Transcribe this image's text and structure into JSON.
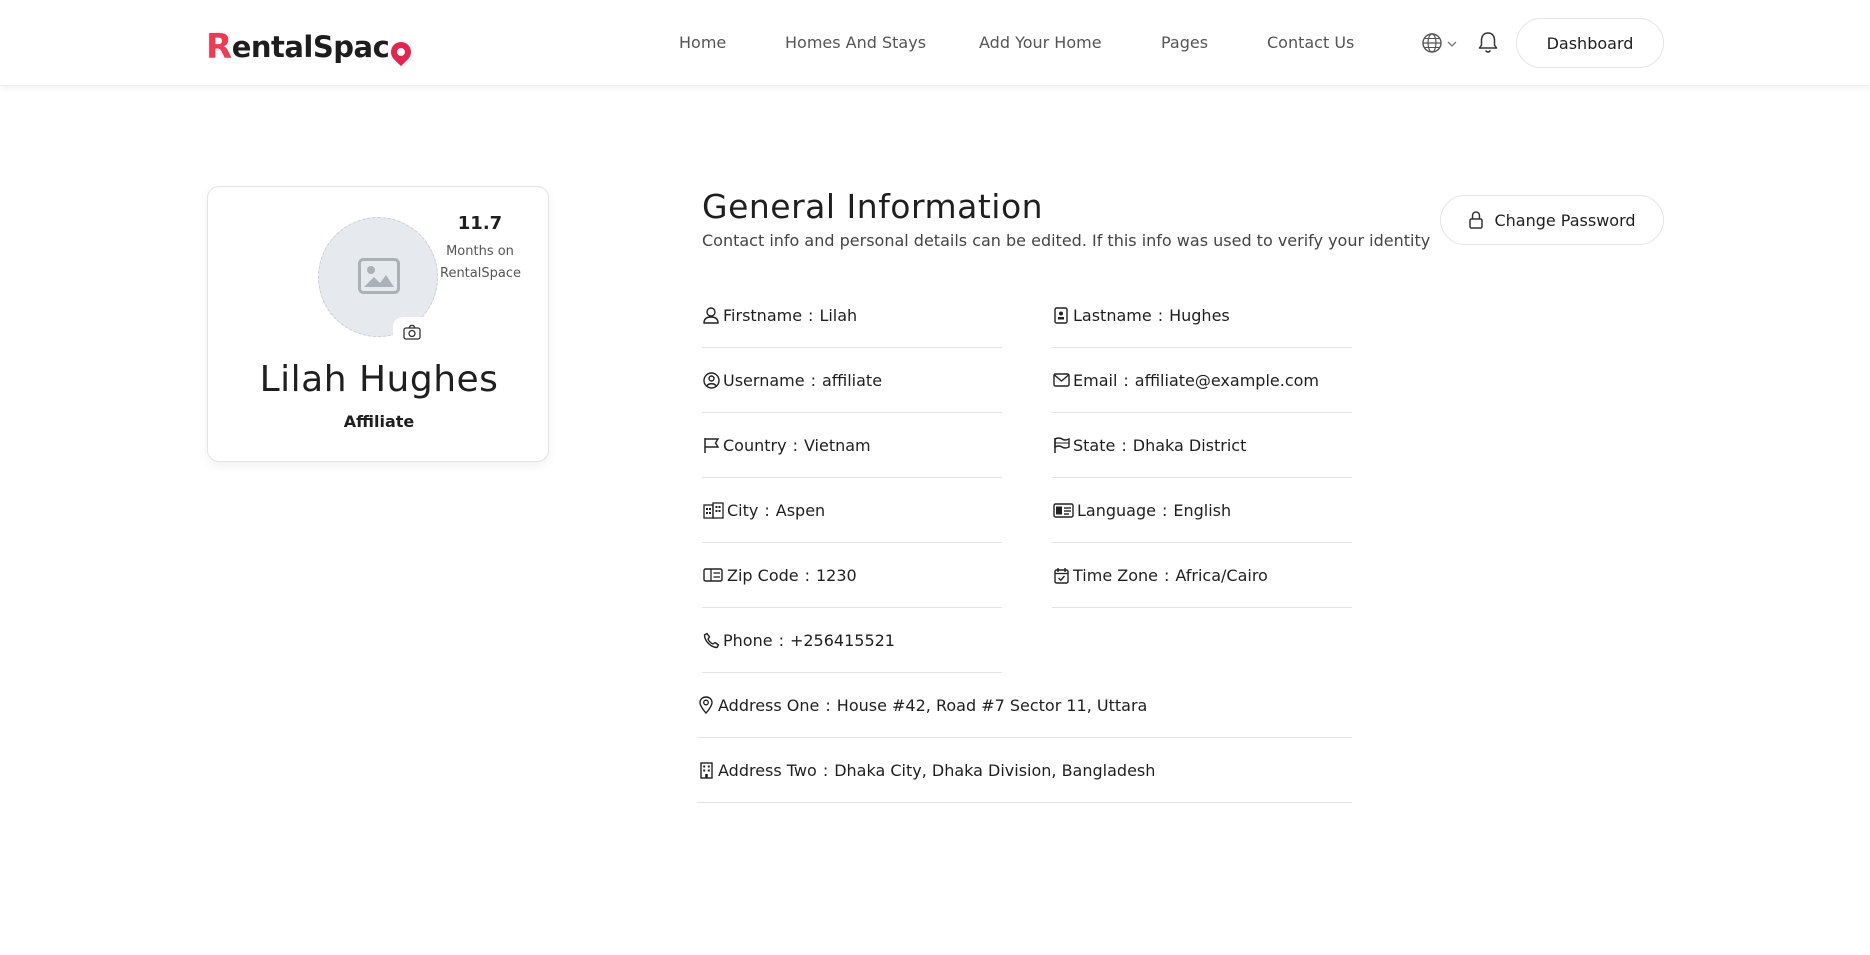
{
  "brand": {
    "logo_first": "R",
    "logo_mid": "entalSpac",
    "logo_last": "e",
    "accent": "#ee3b52"
  },
  "nav": {
    "items": [
      "Home",
      "Homes And Stays",
      "Add Your Home",
      "Pages",
      "Contact Us"
    ],
    "dashboard_label": "Dashboard",
    "icons": [
      "globe-icon",
      "chevron-down-icon",
      "bell-icon"
    ]
  },
  "profile": {
    "months_value": "11.7",
    "months_label_line1": "Months on",
    "months_label_line2": "RentalSpace",
    "name": "Lilah Hughes",
    "role": "Affiliate"
  },
  "general": {
    "title": "General Information",
    "subtitle": "Contact info and personal details can be edited. If this info was used to verify your identity",
    "change_password_label": "Change Password",
    "fields": [
      {
        "icon": "user-icon",
        "label": "Firstname",
        "value": "Lilah"
      },
      {
        "icon": "id-badge-icon",
        "label": "Lastname",
        "value": "Hughes"
      },
      {
        "icon": "user-circle-icon",
        "label": "Username",
        "value": "affiliate"
      },
      {
        "icon": "envelope-icon",
        "label": "Email",
        "value": "affiliate@example.com"
      },
      {
        "icon": "flag-icon",
        "label": "Country",
        "value": "Vietnam"
      },
      {
        "icon": "flag-wave-icon",
        "label": "State",
        "value": "Dhaka District"
      },
      {
        "icon": "buildings-icon",
        "label": "City",
        "value": "Aspen"
      },
      {
        "icon": "language-card-icon",
        "label": "Language",
        "value": "English"
      },
      {
        "icon": "zip-card-icon",
        "label": "Zip Code",
        "value": "1230"
      },
      {
        "icon": "calendar-check-icon",
        "label": "Time Zone",
        "value": "Africa/Cairo"
      },
      {
        "icon": "phone-icon",
        "label": "Phone",
        "value": "+256415521"
      },
      {
        "icon": "map-pin-icon",
        "label": "Address One",
        "value": "House #42, Road #7 Sector 11, Uttara"
      },
      {
        "icon": "building-icon",
        "label": "Address Two",
        "value": "Dhaka City, Dhaka Division, Bangladesh"
      }
    ]
  }
}
